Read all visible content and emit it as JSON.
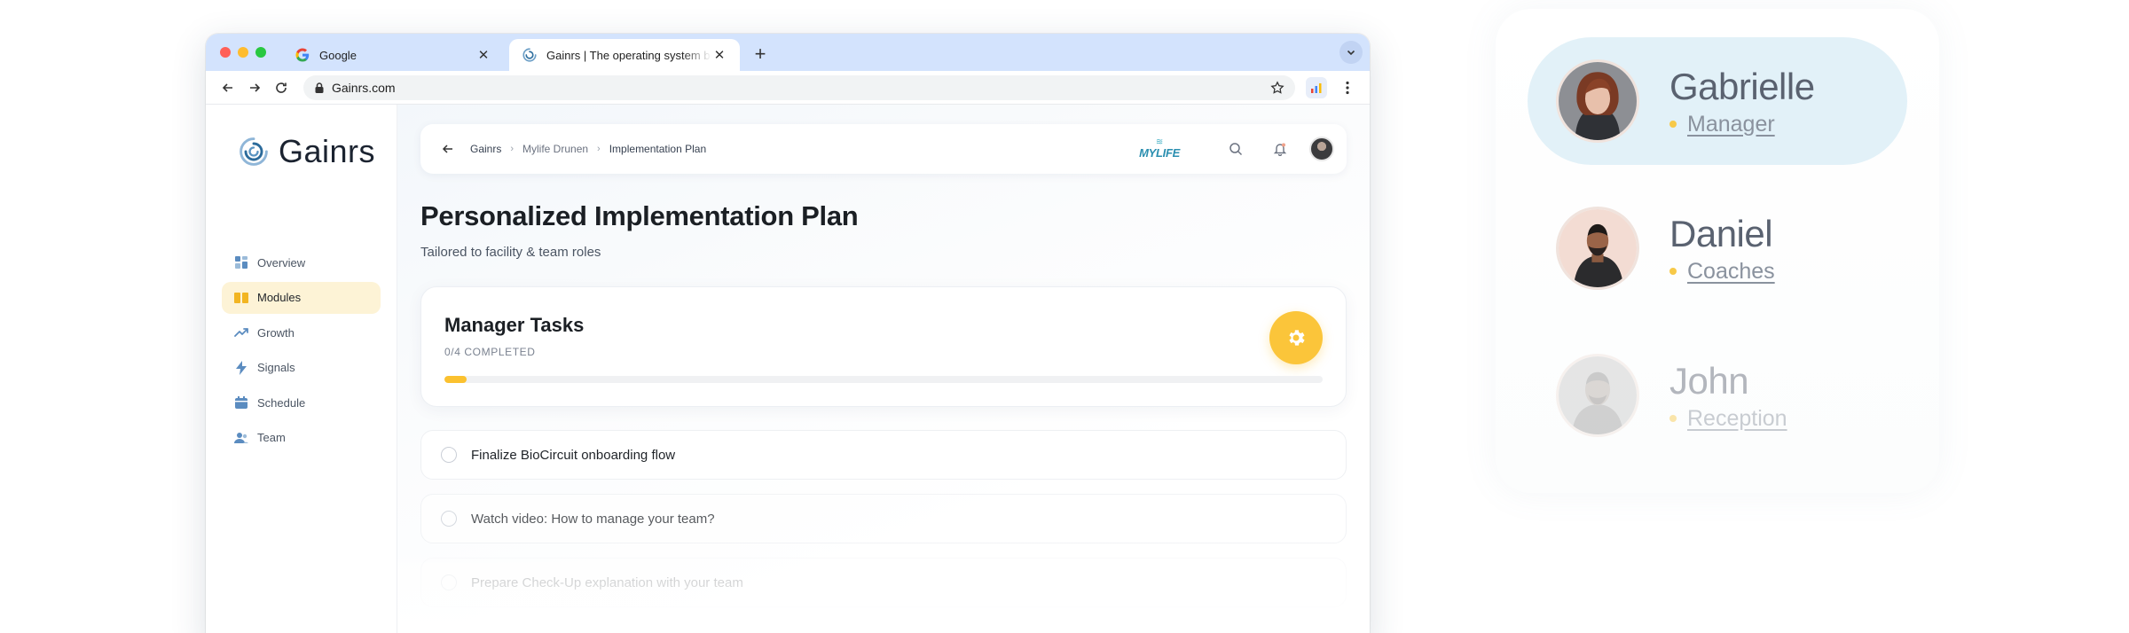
{
  "browser": {
    "tabs": [
      {
        "title": "Google",
        "active": false
      },
      {
        "title": "Gainrs | The operating system behind",
        "active": true
      }
    ],
    "url": "Gainrs.com"
  },
  "brand": {
    "name": "Gainrs"
  },
  "sidebar": {
    "items": [
      {
        "label": "Overview",
        "icon": "grid-icon",
        "active": false
      },
      {
        "label": "Modules",
        "icon": "book-icon",
        "active": true
      },
      {
        "label": "Growth",
        "icon": "trend-icon",
        "active": false
      },
      {
        "label": "Signals",
        "icon": "bolt-icon",
        "active": false
      },
      {
        "label": "Schedule",
        "icon": "calendar-icon",
        "active": false
      },
      {
        "label": "Team",
        "icon": "team-icon",
        "active": false
      }
    ]
  },
  "breadcrumb": {
    "items": [
      "Gainrs",
      "Mylife Drunen",
      "Implementation Plan"
    ]
  },
  "partner_logo": {
    "text": "MYLIFE"
  },
  "page": {
    "title": "Personalized Implementation Plan",
    "subtitle": "Tailored to facility & team roles"
  },
  "task_card": {
    "title": "Manager Tasks",
    "count": "0/4 COMPLETED",
    "progress_fraction": 0.025
  },
  "tasks": [
    {
      "label": "Finalize BioCircuit onboarding flow",
      "done": false
    },
    {
      "label": "Watch video: How to manage your team?",
      "done": false
    },
    {
      "label": "Prepare Check-Up explanation with your team",
      "done": false
    }
  ],
  "roles": [
    {
      "name": "Gabrielle",
      "role": "Manager",
      "selected": true
    },
    {
      "name": "Daniel",
      "role": "Coaches",
      "selected": false
    },
    {
      "name": "John",
      "role": "Reception",
      "selected": false
    }
  ],
  "colors": {
    "accent_yellow": "#fbc53a",
    "tab_bar": "#d3e3fd",
    "selected_role_bg": "#e2f1f8",
    "active_nav_bg": "#fdf3d6"
  }
}
